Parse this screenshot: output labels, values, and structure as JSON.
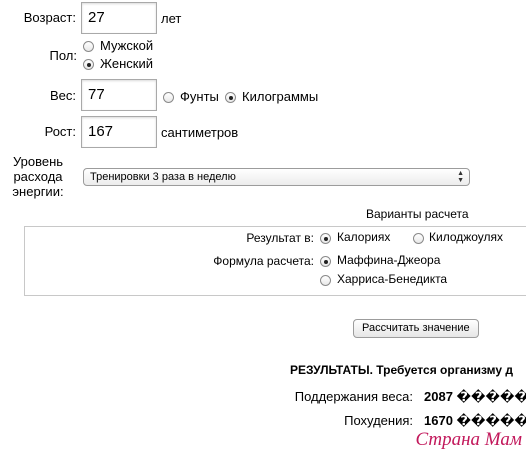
{
  "form": {
    "age_label": "Возраст:",
    "age_value": "27",
    "age_unit": "лет",
    "sex_label": "Пол:",
    "sex_options": [
      {
        "label": "Мужской",
        "selected": false
      },
      {
        "label": "Женский",
        "selected": true
      }
    ],
    "weight_label": "Вес:",
    "weight_value": "77",
    "weight_units": [
      {
        "label": "Фунты",
        "selected": false
      },
      {
        "label": "Килограммы",
        "selected": true
      }
    ],
    "height_label": "Рост:",
    "height_value": "167",
    "height_unit": "сантиметров",
    "activity_label": "Уровень расхода энергии:",
    "activity_label_lines": [
      "Уровень",
      "расхода",
      "энергии:"
    ],
    "activity_selected": "Тренировки 3 раза в неделю"
  },
  "options": {
    "heading": "Варианты расчета",
    "result_in_label": "Результат в:",
    "result_units": [
      {
        "label": "Калориях",
        "selected": true
      },
      {
        "label": "Килоджоулях",
        "selected": false
      }
    ],
    "formula_label": "Формула расчета:",
    "formulas": [
      {
        "label": "Маффина-Джеора",
        "selected": true
      },
      {
        "label": "Харриса-Бенедикта",
        "selected": false
      }
    ]
  },
  "calculate_button": "Рассчитать значение",
  "results": {
    "heading": "РЕЗУЛЬТАТЫ. Требуется организму д",
    "rows": [
      {
        "label": "Поддержания веса:",
        "value": "2087 ������"
      },
      {
        "label": "Похудения:",
        "value": "1670 ������"
      }
    ]
  },
  "watermark": "Страна Мам"
}
